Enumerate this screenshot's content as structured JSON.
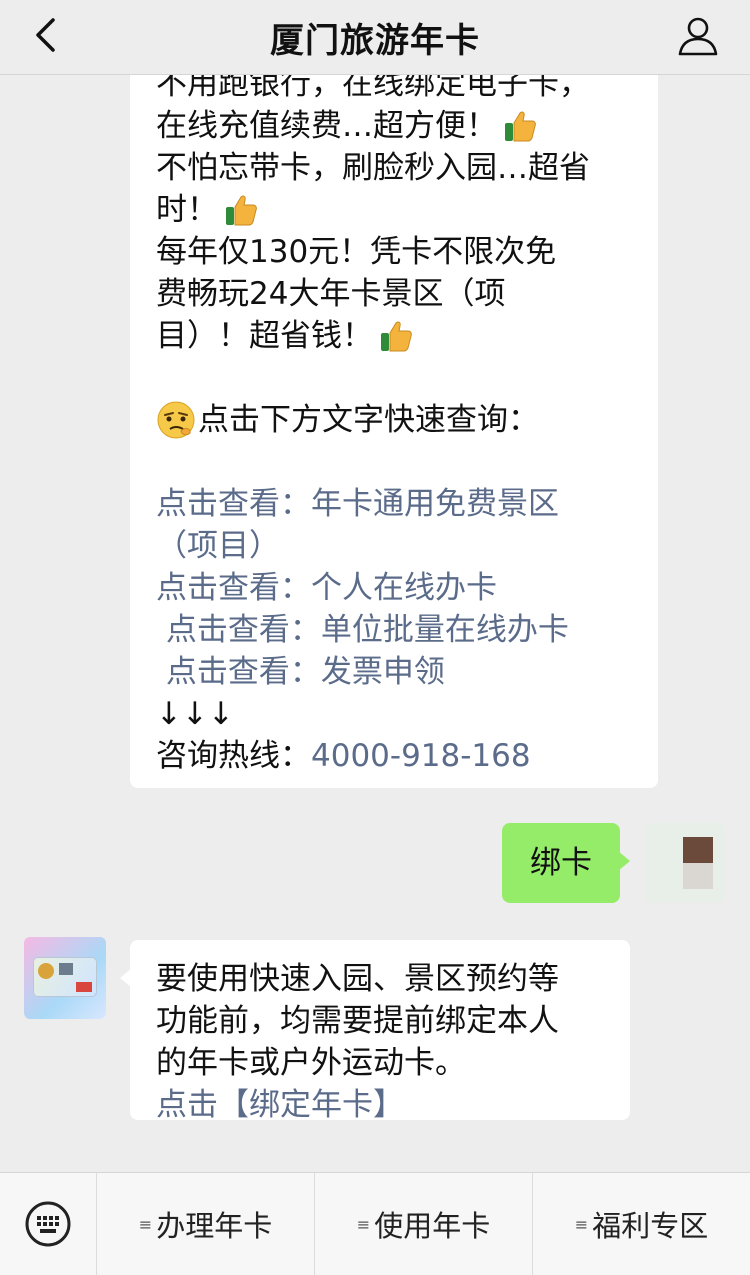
{
  "header": {
    "title": "厦门旅游年卡"
  },
  "messages": {
    "intro": {
      "lines": [
        "不用跑银行，在线绑定电子卡，",
        "在线充值续费…超方便！",
        "不怕忘带卡，刷脸秒入园…超省",
        "时！",
        "每年仅130元！凭卡不限次免",
        "费畅玩24大年卡景区（项",
        "目）！超省钱！",
        "点击下方文字快速查询："
      ],
      "links": [
        "点击查看：年卡通用免费景区",
        "（项目）",
        "点击查看：个人在线办卡",
        " 点击查看：单位批量在线办卡",
        " 点击查看：发票申领"
      ],
      "arrows": "↓↓↓",
      "hotline_label": "咨询热线：",
      "hotline_number": "4000-918-168"
    },
    "user_reply": "绑卡",
    "bot_reply": {
      "lines": [
        "要使用快速入园、景区预约等",
        "功能前，均需要提前绑定本人",
        "的年卡或户外运动卡。"
      ],
      "link": "点击【绑定年卡】"
    }
  },
  "bottom_menu": {
    "items": [
      "办理年卡",
      "使用年卡",
      "福利专区"
    ]
  },
  "colors": {
    "link": "#5b6b8a",
    "user_bubble": "#95ec69",
    "background": "#ededed"
  },
  "icons": [
    "back-arrow-icon",
    "profile-icon",
    "thumbs-up-icon",
    "thinking-face-icon",
    "keyboard-icon",
    "menu-icon"
  ]
}
